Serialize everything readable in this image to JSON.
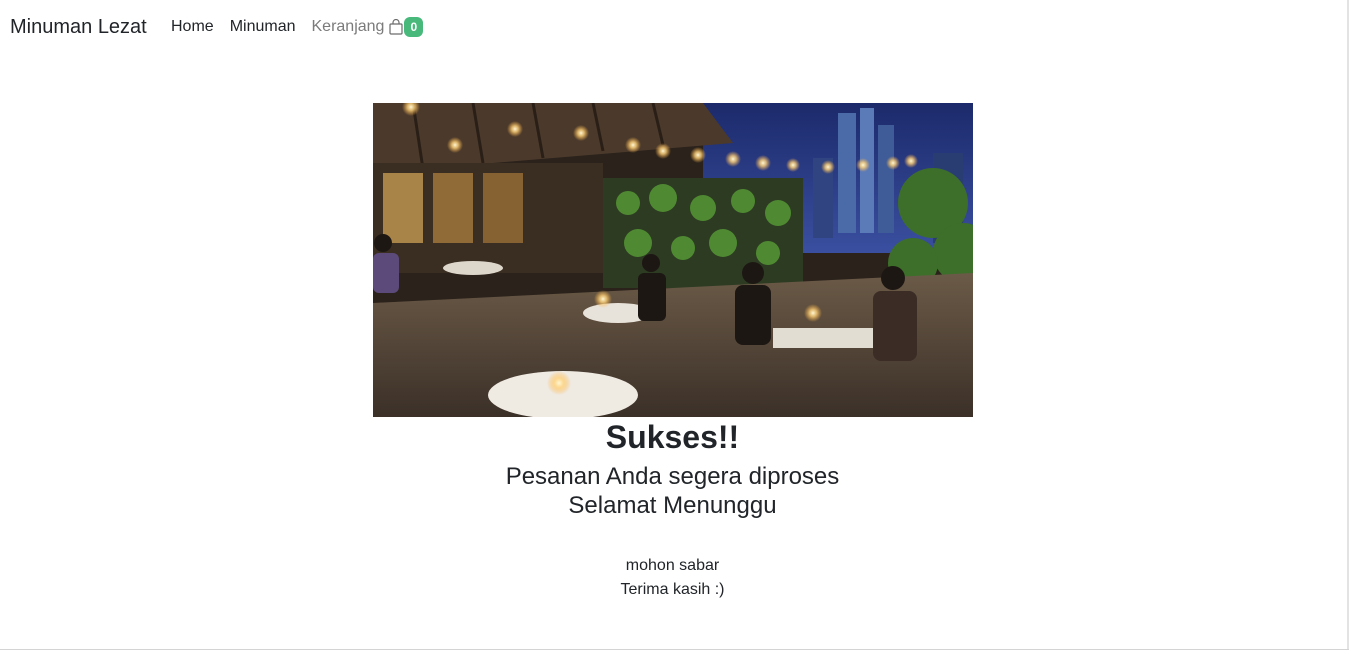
{
  "navbar": {
    "brand": "Minuman Lezat",
    "links": [
      {
        "label": "Home"
      },
      {
        "label": "Minuman"
      },
      {
        "label": "Keranjang"
      }
    ],
    "cart_badge": "0",
    "icons": {
      "cart": "shopping-bag-icon"
    }
  },
  "hero": {
    "image": "rooftop-cafe-night-photo"
  },
  "message": {
    "title": "Sukses!!",
    "line1": "Pesanan Anda segera diproses",
    "line2": "Selamat Menunggu",
    "note1": "mohon sabar",
    "note2": "Terima kasih :)"
  },
  "colors": {
    "badge": "#48b97b",
    "text": "#212529",
    "muted_link": "#7b7b7b"
  }
}
